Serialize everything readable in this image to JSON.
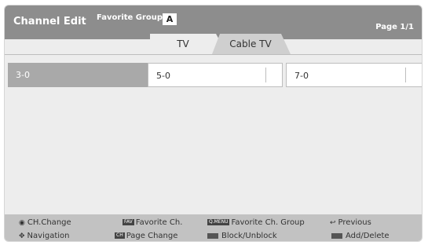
{
  "header": {
    "title": "Channel Edit",
    "favorite_label": "Favorite Group:",
    "favorite_value": "A",
    "page": "Page 1/1"
  },
  "tabs": [
    {
      "label": "TV",
      "active": true
    },
    {
      "label": "Cable TV",
      "active": false
    }
  ],
  "channels": [
    {
      "label": "3-0",
      "selected": true
    },
    {
      "label": "5-0",
      "selected": false
    },
    {
      "label": "7-0",
      "selected": false
    }
  ],
  "footer": {
    "row1": [
      {
        "icon": "ok-icon",
        "label": "CH.Change"
      },
      {
        "tag": "FAV",
        "label": "Favorite Ch."
      },
      {
        "tag": "Q.MENU",
        "label": "Favorite Ch. Group"
      },
      {
        "icon": "back-icon",
        "label": "Previous"
      }
    ],
    "row2": [
      {
        "icon": "arrows-icon",
        "label": "Navigation"
      },
      {
        "tag": "CH",
        "label": "Page Change"
      },
      {
        "icon": "color-key-icon",
        "label": "Block/Unblock"
      },
      {
        "icon": "color-key-icon",
        "label": "Add/Delete"
      }
    ]
  },
  "colors": {
    "header_bg": "#8d8d8d",
    "screen_bg": "#ededed",
    "selected_cell": "#a9a9a9",
    "footer_bg": "#c2c2c2"
  }
}
